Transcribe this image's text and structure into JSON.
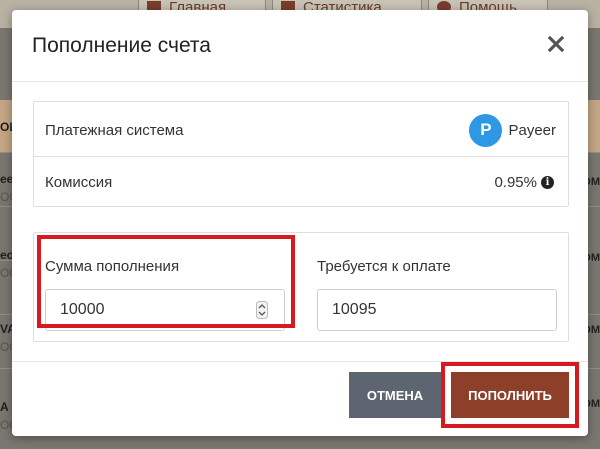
{
  "background": {
    "nav": [
      {
        "label": "Главная",
        "icon": "home-icon"
      },
      {
        "label": "Статистика",
        "icon": "chart-icon"
      },
      {
        "label": "Помощь",
        "icon": "help-icon"
      }
    ],
    "left_fragments": [
      "ОИ",
      "eer",
      "ОСС",
      "eo",
      "ОСС",
      "VA",
      "ОСС",
      "A",
      "ОСС"
    ],
    "right_fragments": [
      "ОМ",
      "ОМ",
      "ОМ",
      "ОМ"
    ]
  },
  "modal": {
    "title": "Пополнение счета",
    "close_icon": "close-icon",
    "payment_system_label": "Платежная система",
    "payment_system_name": "Payeer",
    "payment_system_logo_letter": "P",
    "fee_label": "Комиссия",
    "fee_value": "0.95%",
    "amount_label": "Сумма пополнения",
    "amount_value": "10000",
    "required_label": "Требуется к оплате",
    "required_value": "10095",
    "cancel_label": "ОТМЕНА",
    "submit_label": "ПОПОЛНИТЬ"
  },
  "colors": {
    "highlight": "#d71920",
    "submit_button": "#8e3f2a",
    "cancel_button": "#5d6670",
    "payeer_blue": "#2f98e6"
  }
}
